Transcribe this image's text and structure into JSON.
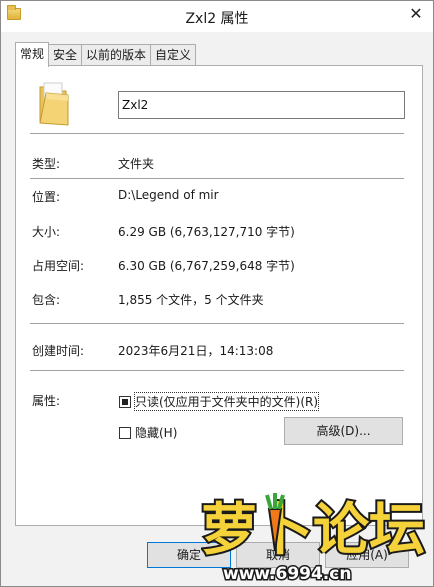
{
  "window": {
    "title": "Zxl2 属性",
    "close_glyph": "✕"
  },
  "tabs": [
    {
      "label": "常规",
      "active": true
    },
    {
      "label": "安全",
      "active": false
    },
    {
      "label": "以前的版本",
      "active": false
    },
    {
      "label": "自定义",
      "active": false
    }
  ],
  "general": {
    "name_value": "Zxl2",
    "icon": "folder-icon",
    "type_label": "类型:",
    "type_value": "文件夹",
    "location_label": "位置:",
    "location_value": "D:\\Legend of mir",
    "size_label": "大小:",
    "size_value": "6.29 GB (6,763,127,710 字节)",
    "disk_size_label": "占用空间:",
    "disk_size_value": "6.30 GB (6,767,259,648 字节)",
    "contains_label": "包含:",
    "contains_value": "1,855 个文件，5 个文件夹",
    "created_label": "创建时间:",
    "created_value": "2023年6月21日，14:13:08",
    "attributes_label": "属性:",
    "readonly_label": "只读(仅应用于文件夹中的文件)(R)",
    "readonly_state": "indeterminate",
    "hidden_label": "隐藏(H)",
    "hidden_state": "unchecked",
    "advanced_label": "高级(D)..."
  },
  "buttons": {
    "ok": "确定",
    "cancel": "取消",
    "apply": "应用(A)"
  },
  "watermark": {
    "text_main": "萝卜论坛",
    "text_url": "www.6994.cn"
  },
  "colors": {
    "focus_border": "#0078d7",
    "button_bg": "#e1e1e1",
    "window_bg": "#f2f2f2"
  }
}
